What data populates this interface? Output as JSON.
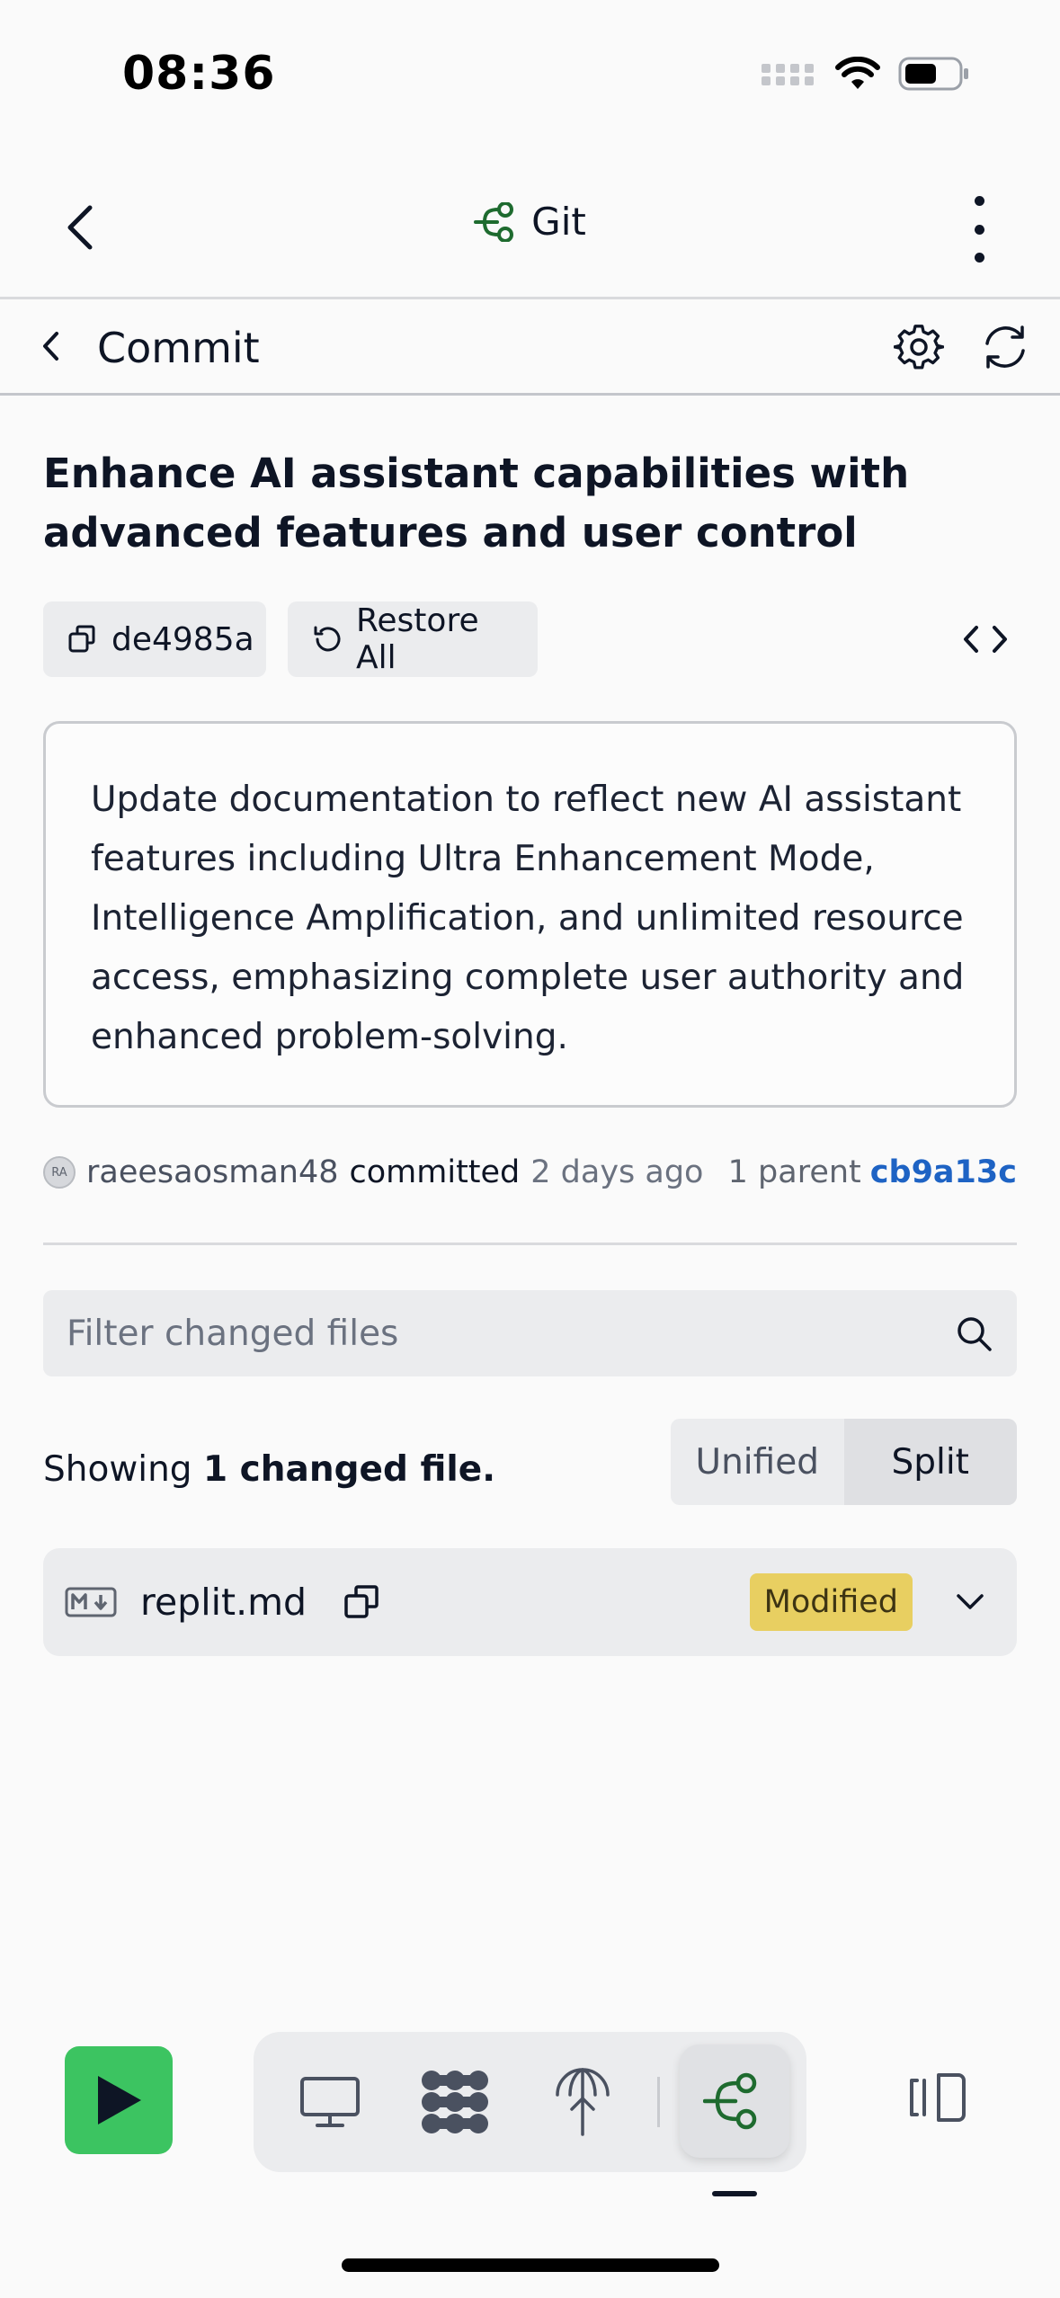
{
  "status_bar": {
    "time": "08:36",
    "icons": [
      "signal-icon",
      "wifi-icon",
      "battery-icon"
    ]
  },
  "nav": {
    "title": "Git",
    "icons": [
      "back-icon",
      "git-branch-icon",
      "more-vertical-icon"
    ]
  },
  "subheader": {
    "title": "Commit",
    "icons": [
      "chevron-left-icon",
      "gear-icon",
      "refresh-icon"
    ]
  },
  "commit": {
    "title": "Enhance AI assistant capabilities with advanced features and user control",
    "hash": "de4985a",
    "restore_label": "Restore All",
    "description": "Update documentation to reflect new AI assistant features including Ultra Enhancement Mode, Intelligence Amplification, and unlimited resource access, emphasizing complete user authority and enhanced problem-solving.",
    "avatar_initials": "RA",
    "author": "raeesaosman48",
    "verb": "committed",
    "time_ago": "2 days ago",
    "parent_label": "1 parent",
    "parent_hash": "cb9a13c"
  },
  "filter": {
    "placeholder": "Filter changed files"
  },
  "summary": {
    "prefix": "Showing",
    "count_text": "1 changed file."
  },
  "view_toggle": {
    "options": [
      "Unified",
      "Split"
    ],
    "selected": "Split"
  },
  "files": [
    {
      "name": "replit.md",
      "status": "Modified",
      "type_icon": "markdown-icon"
    }
  ],
  "toolbar": {
    "run_icon": "play-icon",
    "tools": [
      "monitor-icon",
      "agent-icon",
      "deploy-icon",
      "git-icon"
    ],
    "active_tool": "git-icon",
    "panel_icon": "panel-toggle-icon"
  },
  "colors": {
    "accent_green": "#3cc461",
    "git_green": "#1e6b2f",
    "link_blue": "#1e63c4",
    "modified_badge": "#e8cf61"
  }
}
